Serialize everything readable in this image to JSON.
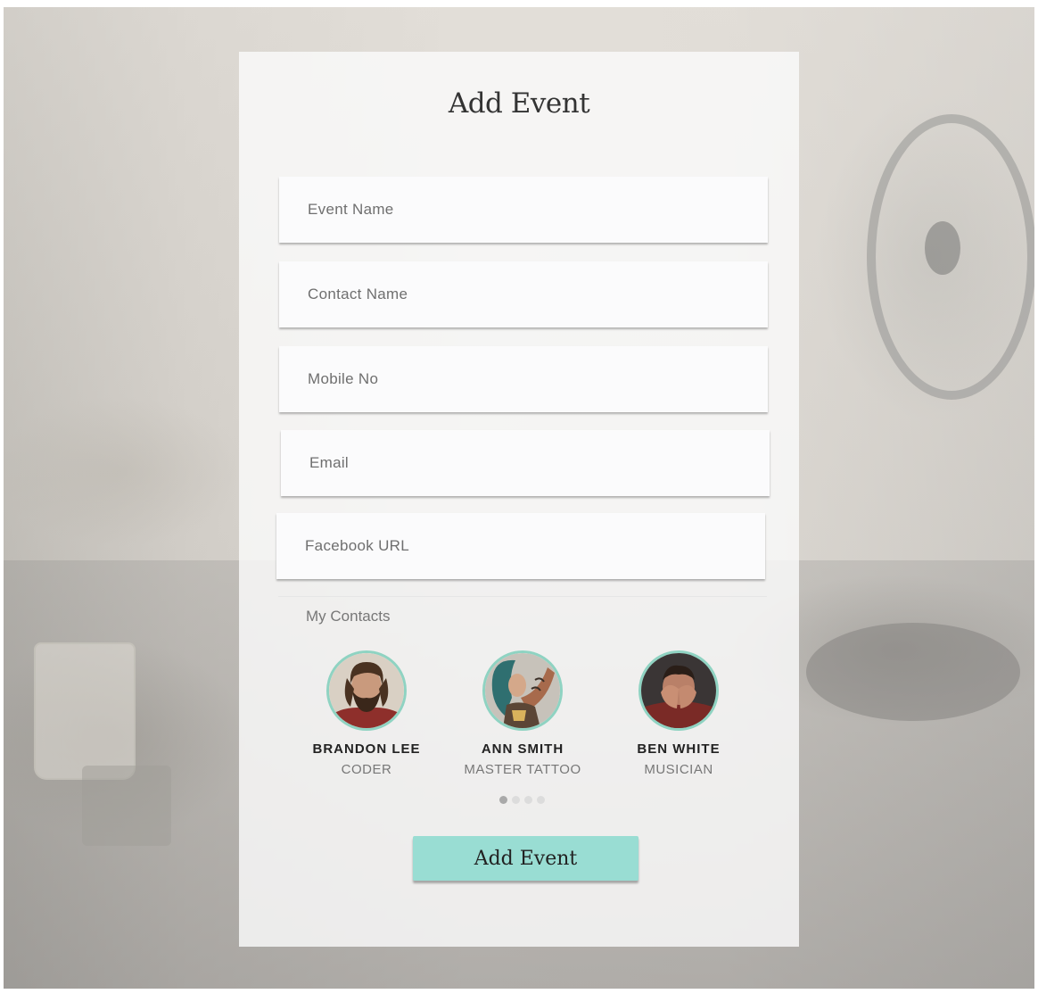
{
  "form": {
    "title": "Add Event",
    "fields": {
      "event_name": {
        "placeholder": "Event Name",
        "value": ""
      },
      "contact_name": {
        "placeholder": "Contact Name",
        "value": ""
      },
      "mobile_no": {
        "placeholder": "Mobile No",
        "value": ""
      },
      "email": {
        "placeholder": "Email",
        "value": ""
      },
      "facebook_url": {
        "placeholder": "Facebook URL",
        "value": ""
      }
    },
    "contacts_label": "My Contacts",
    "contacts": [
      {
        "name": "BRANDON LEE",
        "role": "CODER"
      },
      {
        "name": "ANN SMITH",
        "role": "MASTER TATTOO"
      },
      {
        "name": "BEN WHITE",
        "role": "MUSICIAN"
      }
    ],
    "carousel": {
      "pages": 4,
      "active_page": 1
    },
    "submit_label": "Add Event"
  },
  "colors": {
    "accent": "#99ddd3",
    "avatar_ring": "#8fd3c2"
  }
}
